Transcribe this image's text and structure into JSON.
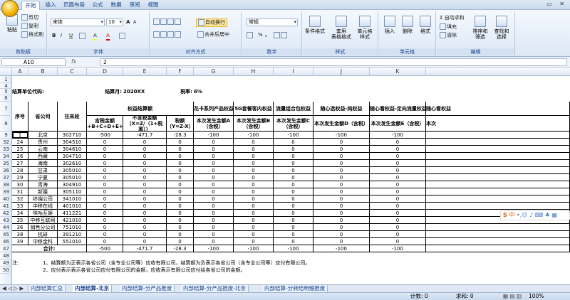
{
  "ribbon": {
    "tabs": [
      "开始",
      "插入",
      "页面布局",
      "公式",
      "数据",
      "审阅",
      "视图"
    ],
    "active_tab": "开始",
    "clipboard": {
      "paste": "粘贴",
      "cut": "剪切",
      "copy": "复制",
      "format_painter": "格式刷",
      "group": "剪贴板"
    },
    "font": {
      "name": "宋体",
      "size": "10",
      "bold": "B",
      "italic": "I",
      "underline": "U",
      "grow": "A",
      "shrink": "A",
      "font_color": "A",
      "fill_color": "A",
      "group": "字体"
    },
    "align": {
      "wrap": "自动换行",
      "merge": "合并后居中",
      "group": "对齐方式"
    },
    "number": {
      "format": "常规",
      "percent": "%",
      "comma": ",",
      "group": "数字"
    },
    "styles": {
      "conditional": "条件格式",
      "table": "套用\n表格格式",
      "cell": "单元格\n样式",
      "group": "样式"
    },
    "cells": {
      "insert": "插入",
      "delete": "删除",
      "format": "格式",
      "group": "单元格"
    },
    "editing": {
      "autosum": "自动求和",
      "fill": "填充",
      "clear": "清除",
      "sort": "排序和\n筛选",
      "find": "查找和\n选择",
      "group": "编辑"
    }
  },
  "formula_bar": {
    "name_box": "A10",
    "fx": "fx",
    "value": "2"
  },
  "columns": [
    "A",
    "B",
    "C",
    "D",
    "E",
    "F",
    "G",
    "H",
    "I",
    "J",
    "K"
  ],
  "header": {
    "unit_label": "结算单位代码:",
    "month_label": "结算月:",
    "month_value": "2020XX",
    "tax_label": "税率:",
    "tax_value": "6%",
    "seq": "序号",
    "province": "省公司",
    "account": "往来段",
    "settle_group": "权益结算额",
    "incl_tax": "含税金额（Z=A+B+C+D+E+F+G+",
    "excl_tax": "不含税金额（X=Z/（1+税率））",
    "tax_amount": "税额（Y=Z-X）",
    "g_title": "花卡系列产品权益",
    "h_title": "5G套餐客内权益",
    "i_title": "流量组合包权益",
    "j_title": "随心选权益-纯权益",
    "k_title": "随心看权益-定向流量权益",
    "l_title": "随心看权益",
    "g_sub": "本次发生金额A（含税）",
    "h_sub": "本次发生金额B（含税）",
    "i_sub": "本次发生金额C（含税）",
    "j_sub": "本次发生金额D（含税）",
    "k_sub": "本次发生金额E（含税）",
    "l_sub": "本次"
  },
  "row_numbers": [
    "1",
    "4",
    "5",
    "6",
    "7",
    "8",
    "9",
    "32",
    "33",
    "34",
    "35",
    "36",
    "37",
    "38",
    "39",
    "40",
    "41",
    "42",
    "43",
    "44",
    "45",
    "46",
    "47",
    "48",
    "49",
    "50"
  ],
  "rows": [
    {
      "n": "9",
      "seq": "1",
      "prov": "北京",
      "acc": "302710",
      "d": "-500",
      "e": "-471.7",
      "f": "-28.3",
      "g": "-100",
      "h": "-100",
      "i": "-100",
      "j": "-100",
      "k": "-100"
    },
    {
      "n": "32",
      "seq": "24",
      "prov": "贵州",
      "acc": "304510",
      "d": "0",
      "e": "0",
      "f": "0",
      "g": "0",
      "h": "0",
      "i": "0",
      "j": "0",
      "k": "0"
    },
    {
      "n": "33",
      "seq": "25",
      "prov": "云南",
      "acc": "304610",
      "d": "0",
      "e": "0",
      "f": "0",
      "g": "0",
      "h": "0",
      "i": "0",
      "j": "0",
      "k": "0"
    },
    {
      "n": "34",
      "seq": "26",
      "prov": "西藏",
      "acc": "304710",
      "d": "0",
      "e": "0",
      "f": "0",
      "g": "0",
      "h": "0",
      "i": "0",
      "j": "0",
      "k": "0"
    },
    {
      "n": "35",
      "seq": "27",
      "prov": "海南",
      "acc": "302610",
      "d": "0",
      "e": "0",
      "f": "0",
      "g": "0",
      "h": "0",
      "i": "0",
      "j": "0",
      "k": "0"
    },
    {
      "n": "36",
      "seq": "28",
      "prov": "甘肃",
      "acc": "305010",
      "d": "0",
      "e": "0",
      "f": "0",
      "g": "0",
      "h": "0",
      "i": "0",
      "j": "0",
      "k": "0"
    },
    {
      "n": "37",
      "seq": "29",
      "prov": "宁夏",
      "acc": "305010",
      "d": "0",
      "e": "0",
      "f": "0",
      "g": "0",
      "h": "0",
      "i": "0",
      "j": "0",
      "k": "0"
    },
    {
      "n": "38",
      "seq": "30",
      "prov": "青海",
      "acc": "304910",
      "d": "0",
      "e": "0",
      "f": "0",
      "g": "0",
      "h": "0",
      "i": "0",
      "j": "0",
      "k": "0"
    },
    {
      "n": "39",
      "seq": "31",
      "prov": "新疆",
      "acc": "305110",
      "d": "0",
      "e": "0",
      "f": "0",
      "g": "0",
      "h": "0",
      "i": "0",
      "j": "0",
      "k": "0"
    },
    {
      "n": "40",
      "seq": "32",
      "prov": "终端公司",
      "acc": "341010",
      "d": "0",
      "e": "0",
      "f": "0",
      "g": "0",
      "h": "0",
      "i": "0",
      "j": "0",
      "k": "0"
    },
    {
      "n": "41",
      "seq": "33",
      "prov": "中移在线",
      "acc": "401010",
      "d": "0",
      "e": "0",
      "f": "0",
      "g": "0",
      "h": "0",
      "i": "0",
      "j": "0",
      "k": "0"
    },
    {
      "n": "42",
      "seq": "34",
      "prov": "咪咕互娱",
      "acc": "411221",
      "d": "0",
      "e": "0",
      "f": "0",
      "g": "0",
      "h": "0",
      "i": "0",
      "j": "0",
      "k": "0"
    },
    {
      "n": "43",
      "seq": "35",
      "prov": "中移互联网",
      "acc": "421010",
      "d": "0",
      "e": "0",
      "f": "0",
      "g": "0",
      "h": "0",
      "i": "0",
      "j": "0",
      "k": "0"
    },
    {
      "n": "44",
      "seq": "36",
      "prov": "销售分公司",
      "acc": "751010",
      "d": "0",
      "e": "0",
      "f": "0",
      "g": "0",
      "h": "0",
      "i": "0",
      "j": "0",
      "k": "0"
    },
    {
      "n": "45",
      "seq": "38",
      "prov": "杭研",
      "acc": "391210",
      "d": "0",
      "e": "0",
      "f": "0",
      "g": "0",
      "h": "0",
      "i": "0",
      "j": "0",
      "k": "0"
    },
    {
      "n": "46",
      "seq": "39",
      "prov": "中移金科",
      "acc": "551010",
      "d": "0",
      "e": "0",
      "f": "0",
      "g": "0",
      "h": "0",
      "i": "0",
      "j": "0",
      "k": "0"
    }
  ],
  "total": {
    "n": "47",
    "label": "合计:",
    "d": "-500",
    "e": "-471.7",
    "f": "-28.3",
    "g": "-100",
    "h": "-100",
    "i": "-100",
    "j": "-100",
    "k": "-100"
  },
  "notes": {
    "label": "注:",
    "line1": "1、结算额为正表示各省公司（含专业公司等）应收有限公司，结算额为负表示各省公司（含专业公司等）应付有限公司。",
    "line2": "2、应付表示表示各省公司应付有限公司的金额，应收表示有限公司应付给各省公司的金额。"
  },
  "sheets": [
    "内部结算汇总",
    "内部结算-北京",
    "内部结算-分产品推度",
    "内部结算-分产品推度-北京",
    "内部结算-分转结明细推度"
  ],
  "status": {
    "count": "计数: 0",
    "sum": "求和: 0",
    "zoom": "100%"
  },
  "ime": {
    "label": "中"
  },
  "colors": {
    "accent": "#15428b",
    "ribbon_bg": "#dde8f6"
  }
}
